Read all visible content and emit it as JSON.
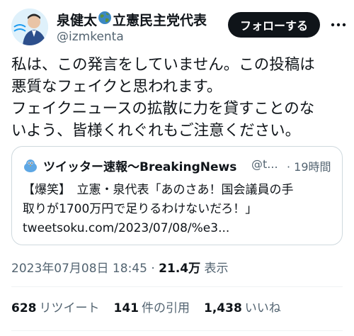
{
  "author": {
    "name_before": "泉健太",
    "name_after": "立憲民主党代表",
    "handle": "@izmkenta"
  },
  "follow_label": "フォローする",
  "tweet_lines": [
    "私は、この発言をしていません。この投稿は",
    "悪質なフェイクと思われます。",
    "フェイクニュースの拡散に力を貸すことのな",
    "いよう、皆様くれぐれもご注意ください。"
  ],
  "quote": {
    "name": "ツイッター速報〜BreakingNews",
    "handle": "@t...",
    "time": "· 19時間",
    "lines": [
      "【爆笑】　立憲・泉代表「あのさあ！国会議員の手",
      "取りが1700万円で足りるわけないだろ！」",
      "tweetsoku.com/2023/07/08/%e3..."
    ]
  },
  "meta": {
    "timestamp": "2023年07月08日 18:45",
    "separator": "·",
    "views": "21.4万",
    "views_label": "表示"
  },
  "stats": {
    "retweets": "628",
    "retweets_label": "リツイート",
    "quotes": "141",
    "quotes_label": "件の引用",
    "likes": "1,438",
    "likes_label": "いいね"
  },
  "colors": {
    "text": "#0f1419",
    "secondary": "#536471",
    "follow_bg": "#0f1419",
    "border": "#cfd9de"
  }
}
